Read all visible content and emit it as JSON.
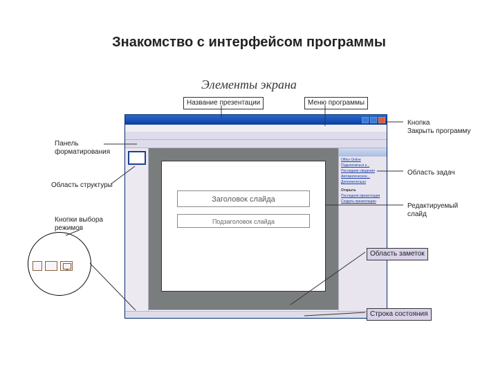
{
  "page_title": "Знакомство с интерфейсом программы",
  "subtitle": "Элементы экрана",
  "labels": {
    "presentation_title": "Название презентации",
    "program_menu": "Меню программы",
    "close_button": "Кнопка\nЗакрыть программу",
    "formatting_panel": "Панель\nформатирования",
    "structure_area": "Область  структуры",
    "view_buttons": "Кнопки выбора\nрежимов",
    "task_pane": "Область задач",
    "editable_slide": "Редактируемый\nслайд",
    "notes_area": "Область заметок",
    "status_bar": "Строка состояния"
  },
  "slide": {
    "title_placeholder": "Заголовок слайда",
    "subtitle_placeholder": "Подзаголовок слайда"
  },
  "taskpane": {
    "header": "Office Online",
    "links": [
      "Подключиться к...",
      "Последние сведения",
      "Автоматическое...",
      "Дополнительно"
    ],
    "section2": "Открыть",
    "links2": [
      "Последняя презентация",
      "Создать презентацию"
    ]
  }
}
